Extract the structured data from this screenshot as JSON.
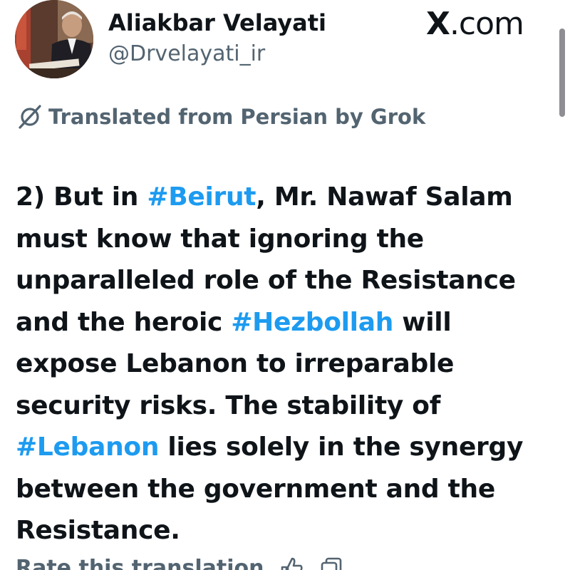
{
  "app": {
    "site_label": "X.com"
  },
  "author": {
    "display_name": "Aliakbar Velayati",
    "handle": "@Drvelayati_ir"
  },
  "translation": {
    "notice": "Translated from Persian by Grok",
    "icon": "grok-icon"
  },
  "tweet": {
    "lines": [
      [
        {
          "t": "2) But in ",
          "h": false
        },
        {
          "t": "#Beirut",
          "h": true
        },
        {
          "t": ", Mr. Nawaf Salam",
          "h": false
        }
      ],
      [
        {
          "t": "must know that ignoring the",
          "h": false
        }
      ],
      [
        {
          "t": "unparalleled role of the Resistance",
          "h": false
        }
      ],
      [
        {
          "t": "and the heroic ",
          "h": false
        },
        {
          "t": "#Hezbollah",
          "h": true
        },
        {
          "t": " will",
          "h": false
        }
      ],
      [
        {
          "t": "expose Lebanon to irreparable",
          "h": false
        }
      ],
      [
        {
          "t": "security risks. The stability of",
          "h": false
        }
      ],
      [
        {
          "t": "#Lebanon",
          "h": true
        },
        {
          "t": " lies solely in the synergy",
          "h": false
        }
      ],
      [
        {
          "t": "between the government and the",
          "h": false
        }
      ],
      [
        {
          "t": "Resistance.",
          "h": false
        }
      ]
    ],
    "hashtag_color": "#1d9bf0",
    "text_color": "#0f1419"
  },
  "footer": {
    "rate_label": "Rate this translation",
    "icons": [
      "thumbs-up-icon",
      "copy-icon"
    ]
  },
  "colors": {
    "secondary_text": "#536471",
    "background": "#ffffff"
  }
}
